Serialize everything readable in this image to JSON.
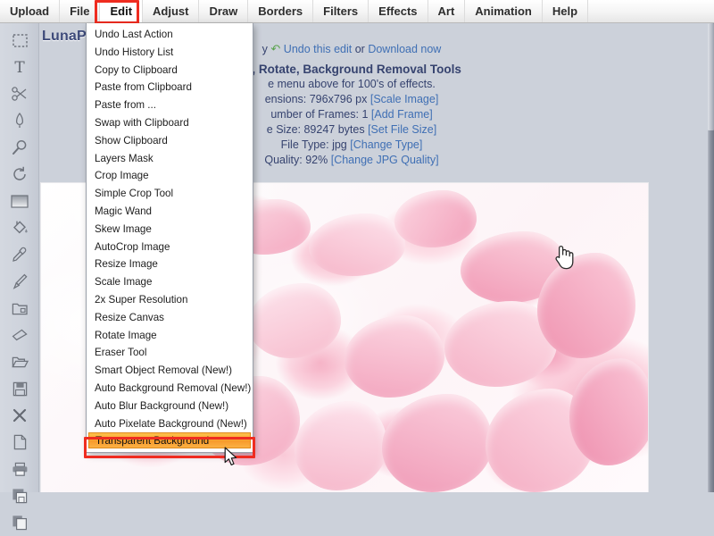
{
  "app": {
    "brand": "LunaPic"
  },
  "menubar": {
    "items": [
      {
        "label": "Upload",
        "name": "menu-upload"
      },
      {
        "label": "File",
        "name": "menu-file"
      },
      {
        "label": "Edit",
        "name": "menu-edit"
      },
      {
        "label": "Adjust",
        "name": "menu-adjust"
      },
      {
        "label": "Draw",
        "name": "menu-draw"
      },
      {
        "label": "Borders",
        "name": "menu-borders"
      },
      {
        "label": "Filters",
        "name": "menu-filters"
      },
      {
        "label": "Effects",
        "name": "menu-effects"
      },
      {
        "label": "Art",
        "name": "menu-art"
      },
      {
        "label": "Animation",
        "name": "menu-animation"
      },
      {
        "label": "Help",
        "name": "menu-help"
      }
    ],
    "selected": "Edit",
    "highlight_color": "#ef2c20"
  },
  "edit_menu": {
    "open": true,
    "highlighted": "Transparent Background",
    "highlight_colors": {
      "fill": "#f9a733",
      "ring": "#ef2c20"
    },
    "items": [
      "Undo Last Action",
      "Undo History List",
      "Copy to Clipboard",
      "Paste from Clipboard",
      "Paste from ...",
      "Swap with Clipboard",
      "Show Clipboard",
      "Layers Mask",
      "Crop Image",
      "Simple Crop Tool",
      "Magic Wand",
      "Skew Image",
      "AutoCrop Image",
      "Resize Image",
      "Scale Image",
      "2x Super Resolution",
      "Resize Canvas",
      "Rotate Image",
      "Eraser Tool",
      "Smart Object Removal (New!)",
      "Auto Background Removal (New!)",
      "Auto Blur Background (New!)",
      "Auto Pixelate Background (New!)",
      "Transparent Background"
    ]
  },
  "toolbar": {
    "tools": [
      {
        "name": "selection-marquee-icon",
        "title": "Selection"
      },
      {
        "name": "text-tool-icon",
        "title": "Text"
      },
      {
        "name": "scissors-icon",
        "title": "Cut"
      },
      {
        "name": "pen-icon",
        "title": "Pen"
      },
      {
        "name": "magnifier-icon",
        "title": "Zoom"
      },
      {
        "name": "rotate-icon",
        "title": "Rotate"
      },
      {
        "name": "gradient-icon",
        "title": "Gradient"
      },
      {
        "name": "paint-bucket-icon",
        "title": "Fill"
      },
      {
        "name": "eyedropper-icon",
        "title": "Color Picker"
      },
      {
        "name": "brush-icon",
        "title": "Brush"
      },
      {
        "name": "crop-folder-icon",
        "title": "Crop"
      },
      {
        "name": "eraser-icon",
        "title": "Eraser"
      },
      {
        "name": "open-folder-icon",
        "title": "Open"
      },
      {
        "name": "save-disk-icon",
        "title": "Save"
      },
      {
        "name": "close-x-icon",
        "title": "Close"
      },
      {
        "name": "new-document-icon",
        "title": "New"
      },
      {
        "name": "printer-icon",
        "title": "Print"
      },
      {
        "name": "save-as-icon",
        "title": "Save As"
      },
      {
        "name": "copy-icon",
        "title": "Copy"
      }
    ]
  },
  "info_panel": {
    "undo_prefix": "y",
    "undo_label": "Undo this edit",
    "or_label": "or",
    "download_label": "Download now",
    "headline": "le, Rotate, Background Removal Tools",
    "subhead": "e menu above for 100's of effects.",
    "dimensions_label": "ensions: 796x796 px",
    "dimensions_action": "[Scale Image]",
    "frames_label": "umber of Frames: 1",
    "frames_action": "[Add Frame]",
    "filesize_label": "e Size: 89247 bytes",
    "filesize_action": "[Set File Size]",
    "filetype_label": "File Type: jpg",
    "filetype_action": "[Change Type]",
    "quality_label": "Quality: 92%",
    "quality_action": "[Change JPG Quality]"
  },
  "canvas": {
    "image_alt": "pink rose petals photo",
    "background": "#ffffff"
  },
  "cursors": {
    "hand": "hand-pointer-cursor",
    "arrow": "arrow-cursor"
  }
}
